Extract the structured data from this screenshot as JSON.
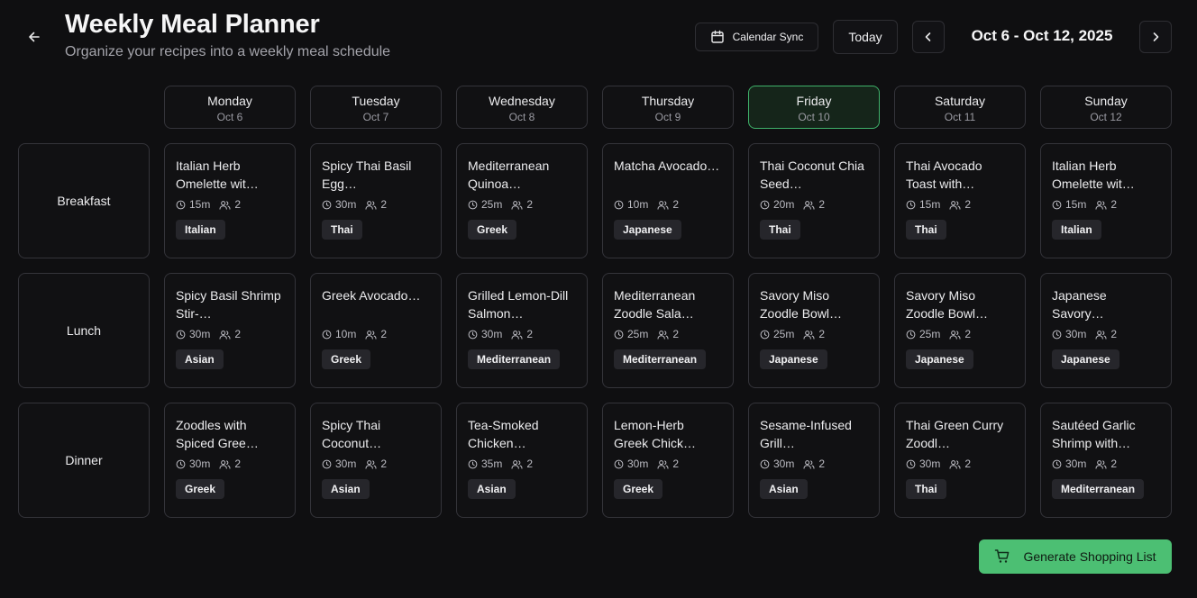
{
  "header": {
    "title": "Weekly Meal Planner",
    "subtitle": "Organize your recipes into a weekly meal schedule",
    "calendar_sync_label": "Calendar Sync",
    "today_label": "Today",
    "date_range": "Oct 6 - Oct 12, 2025"
  },
  "days": [
    {
      "name": "Monday",
      "date": "Oct 6"
    },
    {
      "name": "Tuesday",
      "date": "Oct 7"
    },
    {
      "name": "Wednesday",
      "date": "Oct 8"
    },
    {
      "name": "Thursday",
      "date": "Oct 9"
    },
    {
      "name": "Friday",
      "date": "Oct 10",
      "is_today": true
    },
    {
      "name": "Saturday",
      "date": "Oct 11"
    },
    {
      "name": "Sunday",
      "date": "Oct 12"
    }
  ],
  "meal_types": [
    "Breakfast",
    "Lunch",
    "Dinner"
  ],
  "meals": [
    [
      {
        "title": "Italian Herb Omelette wit…",
        "time": "15m",
        "servings": "2",
        "tag": "Italian"
      },
      {
        "title": "Spicy Thai Basil Egg…",
        "time": "30m",
        "servings": "2",
        "tag": "Thai"
      },
      {
        "title": "Mediterranean Quinoa…",
        "time": "25m",
        "servings": "2",
        "tag": "Greek"
      },
      {
        "title": "Matcha Avocado…",
        "time": "10m",
        "servings": "2",
        "tag": "Japanese"
      },
      {
        "title": "Thai Coconut Chia Seed…",
        "time": "20m",
        "servings": "2",
        "tag": "Thai"
      },
      {
        "title": "Thai Avocado Toast with…",
        "time": "15m",
        "servings": "2",
        "tag": "Thai"
      },
      {
        "title": "Italian Herb Omelette wit…",
        "time": "15m",
        "servings": "2",
        "tag": "Italian"
      }
    ],
    [
      {
        "title": "Spicy Basil Shrimp Stir-…",
        "time": "30m",
        "servings": "2",
        "tag": "Asian"
      },
      {
        "title": "Greek Avocado…",
        "time": "10m",
        "servings": "2",
        "tag": "Greek"
      },
      {
        "title": "Grilled Lemon-Dill Salmon…",
        "time": "30m",
        "servings": "2",
        "tag": "Mediterranean"
      },
      {
        "title": "Mediterranean Zoodle Sala…",
        "time": "25m",
        "servings": "2",
        "tag": "Mediterranean"
      },
      {
        "title": "Savory Miso Zoodle Bowl…",
        "time": "25m",
        "servings": "2",
        "tag": "Japanese"
      },
      {
        "title": "Savory Miso Zoodle Bowl…",
        "time": "25m",
        "servings": "2",
        "tag": "Japanese"
      },
      {
        "title": "Japanese Savory…",
        "time": "30m",
        "servings": "2",
        "tag": "Japanese"
      }
    ],
    [
      {
        "title": "Zoodles with Spiced Gree…",
        "time": "30m",
        "servings": "2",
        "tag": "Greek"
      },
      {
        "title": "Spicy Thai Coconut…",
        "time": "30m",
        "servings": "2",
        "tag": "Asian"
      },
      {
        "title": "Tea-Smoked Chicken…",
        "time": "35m",
        "servings": "2",
        "tag": "Asian"
      },
      {
        "title": "Lemon-Herb Greek Chick…",
        "time": "30m",
        "servings": "2",
        "tag": "Greek"
      },
      {
        "title": "Sesame-Infused Grill…",
        "time": "30m",
        "servings": "2",
        "tag": "Asian"
      },
      {
        "title": "Thai Green Curry Zoodl…",
        "time": "30m",
        "servings": "2",
        "tag": "Thai"
      },
      {
        "title": "Sautéed Garlic Shrimp with…",
        "time": "30m",
        "servings": "2",
        "tag": "Mediterranean"
      }
    ]
  ],
  "footer": {
    "generate_label": "Generate Shopping List"
  },
  "colors": {
    "background": "#0f0f11",
    "accent": "#4cbf73",
    "today_border": "#3fb26a"
  }
}
